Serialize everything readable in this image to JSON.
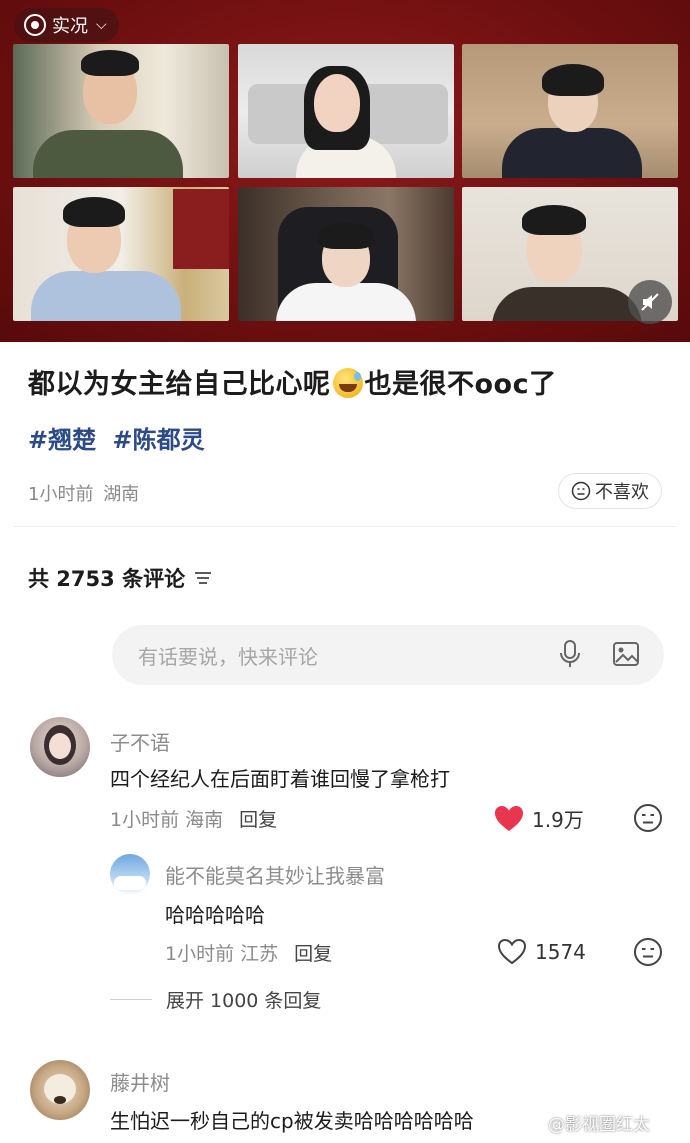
{
  "video": {
    "live_label": "实况",
    "live_chevron": "⌵",
    "tiles": [
      "participant-1",
      "participant-2",
      "participant-3",
      "participant-4",
      "participant-5",
      "participant-6"
    ]
  },
  "post": {
    "title_before": "都以为女主给自己比心呢",
    "title_emoji": "sweat-smile-emoji",
    "title_after": "也是很不ooc了",
    "tags": [
      "#翘楚",
      "#陈都灵"
    ],
    "time": "1小时前",
    "location": "湖南",
    "dislike_label": "不喜欢"
  },
  "comments_header": {
    "count_label": "共 2753 条评论"
  },
  "comment_input": {
    "placeholder": "有话要说，快来评论"
  },
  "comments": [
    {
      "name": "子不语",
      "text": "四个经纪人在后面盯着谁回慢了拿枪打",
      "time": "1小时前",
      "location": "海南",
      "reply_label": "回复",
      "likes": "1.9万",
      "liked": true
    },
    {
      "name": "能不能莫名其妙让我暴富",
      "text": "哈哈哈哈哈",
      "time": "1小时前",
      "location": "江苏",
      "reply_label": "回复",
      "likes": "1574",
      "liked": false
    },
    {
      "name": "藤井树",
      "text": "生怕迟一秒自己的cp被发卖哈哈哈哈哈哈"
    }
  ],
  "expand_replies": {
    "label": "展开 1000 条回复"
  },
  "watermark": {
    "text": "@影视圈红太"
  },
  "colors": {
    "video_bg": "#6e0f10",
    "tag_blue": "#2c4a86",
    "like_red": "#e8364f",
    "meta_gray": "#8a8a8a"
  }
}
